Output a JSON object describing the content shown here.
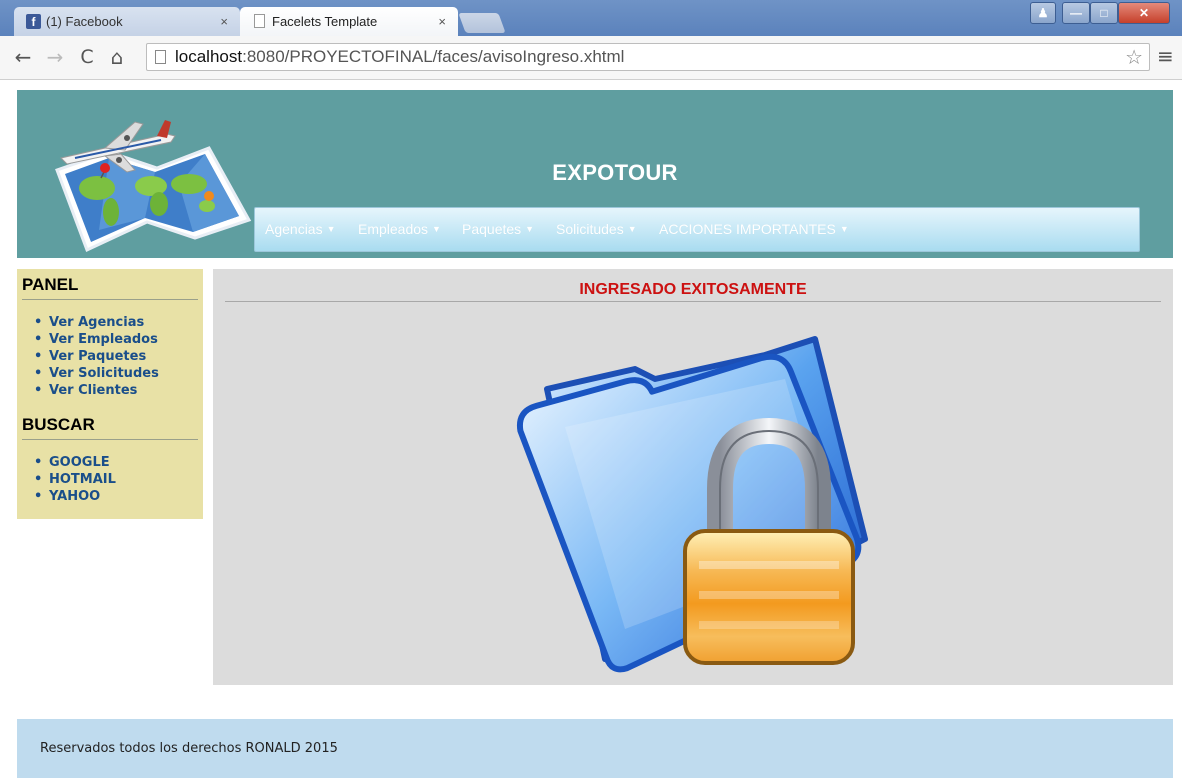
{
  "browser": {
    "tabs": [
      {
        "title": "(1) Facebook",
        "close": "×",
        "icon": "facebook-icon"
      },
      {
        "title": "Facelets Template",
        "close": "×",
        "icon": "page-icon"
      }
    ],
    "url_host": "localhost",
    "url_rest": ":8080/PROYECTOFINAL/faces/avisoIngreso.xhtml",
    "nav": {
      "back": "←",
      "forward": "→",
      "reload": "C",
      "home": "⌂",
      "star": "☆",
      "menu": "≡"
    }
  },
  "header": {
    "title": "EXPOTOUR",
    "menu": [
      {
        "label": "Agencias",
        "caret": "▼"
      },
      {
        "label": "Empleados",
        "caret": "▼"
      },
      {
        "label": "Paquetes",
        "caret": "▼"
      },
      {
        "label": "Solicitudes",
        "caret": "▼"
      },
      {
        "label": "ACCIONES IMPORTANTES",
        "caret": "▼"
      }
    ]
  },
  "panel": {
    "title": "PANEL",
    "items": [
      "Ver Agencias",
      "Ver Empleados",
      "Ver Paquetes",
      "Ver Solicitudes",
      "Ver Clientes"
    ],
    "search_title": "BUSCAR",
    "search_items": [
      "GOOGLE",
      "HOTMAIL",
      "YAHOO"
    ]
  },
  "content": {
    "message": "INGRESADO EXITOSAMENTE",
    "image": "folder-lock-icon"
  },
  "footer": {
    "text": "Reservados todos los derechos RONALD 2015"
  },
  "colors": {
    "header_bg": "#5f9ea0",
    "panel_bg": "#e8e1a6",
    "content_bg": "#dcdcdc",
    "footer_bg": "#bfdbee",
    "message": "#cc1111",
    "link": "#1a4e8a"
  }
}
